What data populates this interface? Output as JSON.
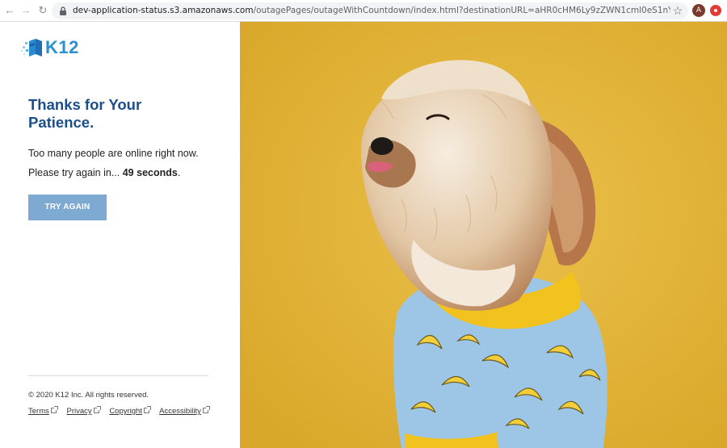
{
  "browser": {
    "url_host": "dev-application-status.s3.amazonaws.com",
    "url_path": "/outagePages/outageWithCountdown/index.html?destinationURL=aHR0cHM6Ly9zZWN1cml0eS1nYXRld2F5LmsxMi5jb20vc2VjdXJpdHk...",
    "profile_initial": "A"
  },
  "page": {
    "logo_text": "K12",
    "heading": "Thanks for Your Patience.",
    "message_line1": "Too many people are online right now.",
    "message_line2_prefix": "Please try again in... ",
    "countdown": "49 seconds",
    "message_line2_suffix": ".",
    "try_again_label": "TRY AGAIN",
    "copyright": "© 2020 K12 Inc. All rights reserved.",
    "footer_links": [
      "Terms",
      "Privacy",
      "Copyright",
      "Accessibility"
    ]
  },
  "colors": {
    "heading": "#1b4f8c",
    "button": "#7ea9d0",
    "hero_background": "#e5b636",
    "logo": "#2d8fd1"
  }
}
